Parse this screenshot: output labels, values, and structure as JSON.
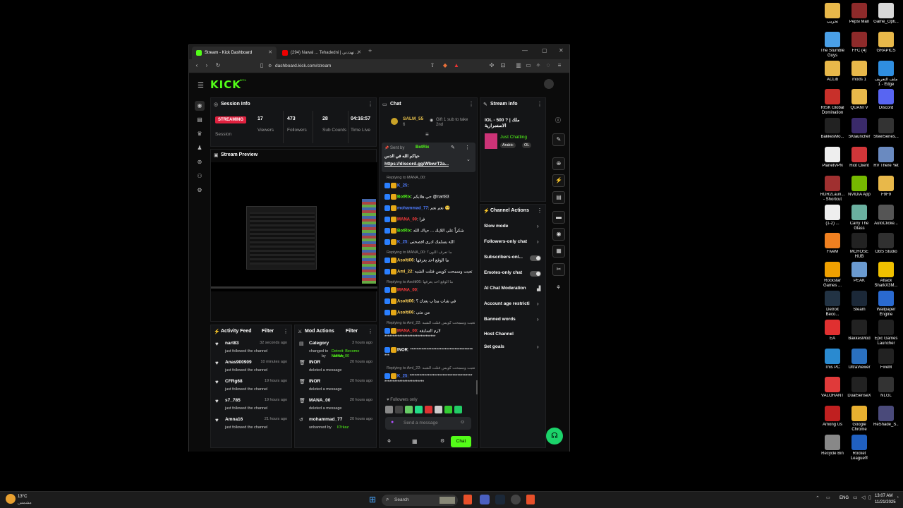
{
  "desktop_icons": [
    {
      "label": "تحريب",
      "color": "#e8b84a",
      "name": "folder-icon"
    },
    {
      "label": "Pepsi Man",
      "color": "#8e2a2a",
      "name": "winrar-icon"
    },
    {
      "label": "Game_Opti...",
      "color": "#d8d8d8",
      "name": "file-icon"
    },
    {
      "label": "The Stumble Guys",
      "color": "#4aa0e8",
      "name": "stumble-guys-icon"
    },
    {
      "label": "FFC (4)",
      "color": "#8e2a2a",
      "name": "winrar-icon"
    },
    {
      "label": "GRAPICS",
      "color": "#e8b84a",
      "name": "folder-icon"
    },
    {
      "label": "ACLib",
      "color": "#e8b84a",
      "name": "folder-icon"
    },
    {
      "label": "mods 1",
      "color": "#e8b84a",
      "name": "folder-icon"
    },
    {
      "label": "ملف التعريف 1 - Edge",
      "color": "#2f8ee0",
      "name": "edge-icon"
    },
    {
      "label": "RISK Global Domination",
      "color": "#c8302a",
      "name": "risk-icon"
    },
    {
      "label": "QUANTV",
      "color": "#e8b84a",
      "name": "folder-icon"
    },
    {
      "label": "Discord",
      "color": "#5865f2",
      "name": "discord-icon"
    },
    {
      "label": "BakkesMo...",
      "color": "#222222",
      "name": "bakkesmod-icon"
    },
    {
      "label": "SKlauncher",
      "color": "#3a2a6a",
      "name": "sklauncher-icon"
    },
    {
      "label": "SteelSeries...",
      "color": "#333333",
      "name": "steelseries-icon"
    },
    {
      "label": "PlanetVPN",
      "color": "#eeeeee",
      "name": "file-icon"
    },
    {
      "label": "Riot Client",
      "color": "#d13639",
      "name": "riot-icon"
    },
    {
      "label": "RV There Yet",
      "color": "#6a8ac0",
      "name": "game-icon"
    },
    {
      "label": "RDR2Laun... - Shortcut",
      "color": "#a03030",
      "name": "rdr2-icon"
    },
    {
      "label": "NVIDIA App",
      "color": "#76b900",
      "name": "nvidia-icon"
    },
    {
      "label": "F9F9",
      "color": "#e8b84a",
      "name": "folder-icon"
    },
    {
      "label": "(1-2) ...",
      "color": "#eeeeee",
      "name": "file-icon"
    },
    {
      "label": "Carry The Glass",
      "color": "#6ab0a0",
      "name": "game-icon"
    },
    {
      "label": "AutoClicke...",
      "color": "#555555",
      "name": "mouse-icon"
    },
    {
      "label": "FiveM",
      "color": "#f08020",
      "name": "fivem-icon"
    },
    {
      "label": "MCHOSE HUB",
      "color": "#222222",
      "name": "mchose-icon"
    },
    {
      "label": "OBS Studio",
      "color": "#303030",
      "name": "obs-icon"
    },
    {
      "label": "Rockstar Games ...",
      "color": "#f0a000",
      "name": "rockstar-icon"
    },
    {
      "label": "PEAK",
      "color": "#6a9ad0",
      "name": "peak-icon"
    },
    {
      "label": "Attack SharkX3M...",
      "color": "#f0c000",
      "name": "shark-icon"
    },
    {
      "label": "Detroit Beco...",
      "color": "#223344",
      "name": "detroit-icon"
    },
    {
      "label": "Steam",
      "color": "#1b2838",
      "name": "steam-icon"
    },
    {
      "label": "Wallpaper Engine",
      "color": "#2a6ad0",
      "name": "wallpaper-engine-icon"
    },
    {
      "label": "EA",
      "color": "#e03030",
      "name": "ea-icon"
    },
    {
      "label": "BakkesMod",
      "color": "#222222",
      "name": "bakkesmod-icon"
    },
    {
      "label": "Epic Games Launcher",
      "color": "#222222",
      "name": "epic-icon"
    },
    {
      "label": "This PC",
      "color": "#2a8ad0",
      "name": "pc-icon"
    },
    {
      "label": "UltraViewer",
      "color": "#2a70c0",
      "name": "ultraviewer-icon"
    },
    {
      "label": "FiveM",
      "color": "#222222",
      "name": "fivem-icon"
    },
    {
      "label": "VALORANT",
      "color": "#e03a3a",
      "name": "valorant-icon"
    },
    {
      "label": "DualSenseX",
      "color": "#222222",
      "name": "dualsense-icon"
    },
    {
      "label": "NLGL",
      "color": "#333333",
      "name": "nlgl-icon"
    },
    {
      "label": "Among Us",
      "color": "#c02020",
      "name": "among-us-icon"
    },
    {
      "label": "Google Chrome",
      "color": "#e8b030",
      "name": "chrome-icon"
    },
    {
      "label": "ReShade_S...",
      "color": "#4a4a7a",
      "name": "reshade-icon"
    },
    {
      "label": "Recycle Bin",
      "color": "#888888",
      "name": "recycle-bin-icon"
    },
    {
      "label": "Rocket League®",
      "color": "#2060c0",
      "name": "rocket-league-icon"
    }
  ],
  "browser": {
    "tabs": [
      {
        "label": "Stream - Kick Dashboard",
        "active": true
      },
      {
        "label": "(294) Nawal ... Tehadedni | تهددني ..."
      }
    ],
    "new_tab": "+",
    "url": "dashboard.kick.com/stream",
    "window_controls": {
      "minimize": "—",
      "maximize": "▢",
      "close": "✕"
    }
  },
  "kick": {
    "logo": "KICK",
    "logo_tag": "BETA",
    "session": {
      "title": "Session Info",
      "status": "STREAMING",
      "session_label": "Session",
      "stats": [
        {
          "value": "17",
          "label": "Viewers"
        },
        {
          "value": "473",
          "label": "Followers"
        },
        {
          "value": "28",
          "label": "Sub Counts"
        },
        {
          "value": "04:16:57",
          "label": "Time Live"
        }
      ]
    },
    "preview_title": "Stream Preview",
    "activity": {
      "title": "Activity Feed",
      "filter": "Filter",
      "items": [
        {
          "user": "nart83",
          "time": "32 seconds ago",
          "desc": "just followed the channel"
        },
        {
          "user": "Anas900909",
          "time": "10 minutes ago",
          "desc": "just followed the channel"
        },
        {
          "user": "CFRg68",
          "time": "19 hours ago",
          "desc": "just followed the channel"
        },
        {
          "user": "s7_785",
          "time": "19 hours ago",
          "desc": "just followed the channel"
        },
        {
          "user": "Amna16",
          "time": "21 hours ago",
          "desc": "just followed the channel"
        }
      ]
    },
    "mod": {
      "title": "Mod Actions",
      "filter": "Filter",
      "items": [
        {
          "user": "Category",
          "time": "3 hours ago",
          "desc": "changed to",
          "detail": "Detroit: Become Human",
          "by": "by",
          "target": "MANA_00"
        },
        {
          "user": "INOR",
          "time": "20 hours ago",
          "desc": "deleted a message"
        },
        {
          "user": "INOR",
          "time": "20 hours ago",
          "desc": "deleted a message"
        },
        {
          "user": "MANA_00",
          "time": "20 hours ago",
          "desc": "deleted a message"
        },
        {
          "user": "mohammad_77",
          "time": "20 hours ago",
          "desc": "unbanned by",
          "target": "Il7rkaz"
        }
      ]
    },
    "chat": {
      "title": "Chat",
      "top_gifter": "SALM_55",
      "top_gifter_count": "6",
      "gift_text": "Gift 1 sub to take 2nd",
      "pinned_by_label": "Sent by",
      "pinned_by": "BotRix",
      "pinned_text": "حياكم الله في الدس",
      "pinned_link": "https://discord.gg/WbwrT2a...",
      "lines": [
        {
          "reply": "Replying to MANA_00:",
          "user": "K_25",
          "userColor": "#4f7cff",
          "text": ""
        },
        {
          "user": "BotRix",
          "userColor": "#53fc18",
          "text": "حي هلابكم @nart83"
        },
        {
          "user": "mohammad_77",
          "userColor": "#4f7cff",
          "text": "نعم نعم 🥺"
        },
        {
          "user": "MANA_00",
          "userColor": "#ff3b3b",
          "text": "فرا"
        },
        {
          "user": "BotRix",
          "userColor": "#53fc18",
          "text": "شكراً على اللايك ... حياك الله"
        },
        {
          "user": "K_25",
          "userColor": "#4f7cff",
          "text": "الله يسلمك ادري افصحتي"
        },
        {
          "reply": "Replying to MANA_00: ما تعرف اللون؟",
          "user": "Asolti06",
          "userColor": "#ffd25a",
          "text": "ما الوقع احد يعرفها"
        },
        {
          "user": "Aml_22",
          "userColor": "#ffd25a",
          "text": "تعبت وسمحت كويس فتلت الشبه"
        },
        {
          "reply": "Replying to Asolti06: ما الوقع احد يعرفها",
          "user": "MANA_00",
          "userColor": "#ff3b3b",
          "text": ""
        },
        {
          "user": "Asolti06",
          "userColor": "#ffd25a",
          "text": "في شات مذاب بعدك ؟"
        },
        {
          "user": "Asolti06",
          "userColor": "#ffd25a",
          "text": "من متى"
        },
        {
          "reply": "Replying to Aml_22: تعبت وسمحت كويس فتلت الشبه",
          "user": "MANA_00",
          "userColor": "#ff3b3b",
          "text": "لازم السابقه *******************************"
        },
        {
          "user": "INOR",
          "userColor": "#ffffff",
          "text": "************************************** ***"
        },
        {
          "reply": "Replying to Aml_22: تعبت وسمحت كويس فتلت الشبه",
          "user": "K_25",
          "userColor": "#4f7cff",
          "text": "************************************** ************************"
        }
      ],
      "followers_only": "Followers only",
      "placeholder": "Send a message",
      "send": "Chat"
    },
    "stream_info": {
      "title": "Stream info",
      "stream_title": "IOL - 500 ? | ملك الاستمرارية",
      "category": "Just Chatting",
      "tags": [
        "Arabic",
        "OL"
      ]
    },
    "channel_actions": {
      "title": "Channel Actions",
      "items": [
        {
          "label": "Slow mode",
          "kind": "arrow"
        },
        {
          "label": "Followers-only chat",
          "kind": "arrow"
        },
        {
          "label": "Subscribers-onl...",
          "kind": "toggle"
        },
        {
          "label": "Emotes-only chat",
          "kind": "toggle"
        },
        {
          "label": "AI Chat Moderation",
          "kind": "chart"
        },
        {
          "label": "Account age restricti",
          "kind": "arrow"
        },
        {
          "label": "Banned words",
          "kind": "arrow"
        },
        {
          "label": "Host Channel",
          "kind": "none"
        },
        {
          "label": "Set goals",
          "kind": "arrow"
        }
      ]
    }
  },
  "taskbar": {
    "weather_temp": "13°C",
    "weather_desc": "مشمس",
    "search": "Search",
    "lang": "ENG",
    "time": "13:07 AM",
    "date": "11/21/2025"
  }
}
